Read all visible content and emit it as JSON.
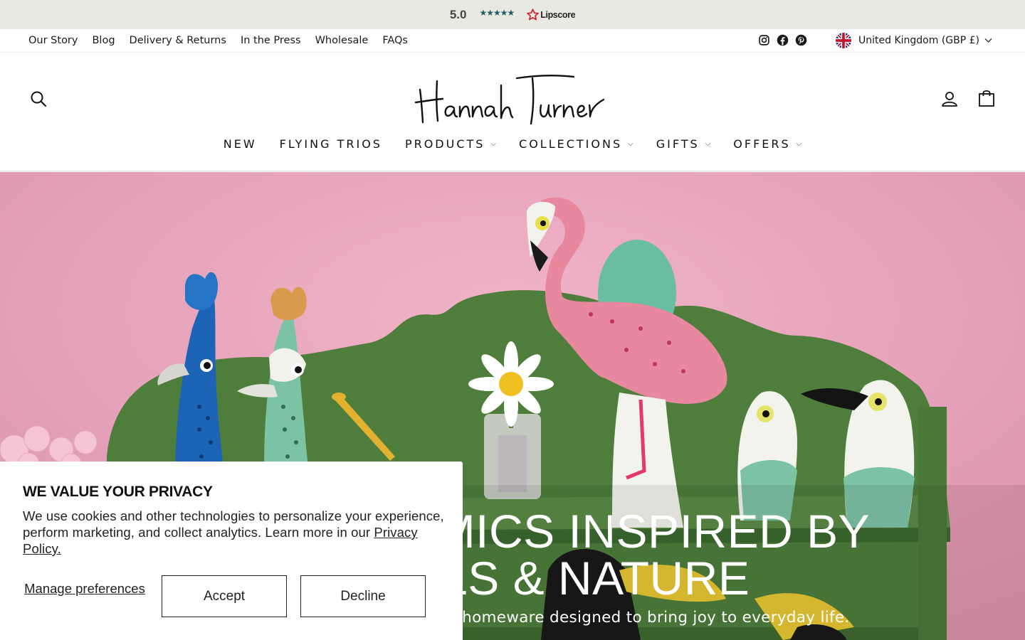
{
  "rating_bar": {
    "score": "5.0",
    "stars": "★★★★★",
    "provider": "Lipscore"
  },
  "utility_nav": {
    "links": [
      "Our Story",
      "Blog",
      "Delivery & Returns",
      "In the Press",
      "Wholesale",
      "FAQs"
    ],
    "social_icons": [
      "instagram-icon",
      "facebook-icon",
      "pinterest-icon"
    ],
    "locale": "United Kingdom (GBP £)"
  },
  "header": {
    "logo_text": "Hannah Turner",
    "icons": [
      "search-icon",
      "account-icon",
      "bag-icon"
    ]
  },
  "main_nav": {
    "items": [
      {
        "label": "NEW",
        "has_dropdown": false
      },
      {
        "label": "FLYING TRIOS",
        "has_dropdown": false
      },
      {
        "label": "PRODUCTS",
        "has_dropdown": true
      },
      {
        "label": "COLLECTIONS",
        "has_dropdown": true
      },
      {
        "label": "GIFTS",
        "has_dropdown": true
      },
      {
        "label": "OFFERS",
        "has_dropdown": true
      }
    ],
    "caret": "⌵"
  },
  "hero": {
    "title_line1": "RAMICS INSPIRED BY",
    "title_line2": "MALS & NATURE",
    "subtitle": "nakers and homeware designed to bring joy to everyday life."
  },
  "cookie_banner": {
    "title": "WE VALUE YOUR PRIVACY",
    "text": "We use cookies and other technologies to personalize your experience, perform marketing, and collect analytics. Learn more in our ",
    "link": "Privacy Policy.",
    "manage_label": "Manage preferences",
    "accept_label": "Accept",
    "decline_label": "Decline"
  },
  "colors": {
    "rating_bar_bg": "#e9e9e2",
    "stars": "#1f5e63",
    "lipscore_red": "#d42029",
    "hero_pink": "#e7a6bd",
    "shelf_green": "#4f7d3c"
  }
}
